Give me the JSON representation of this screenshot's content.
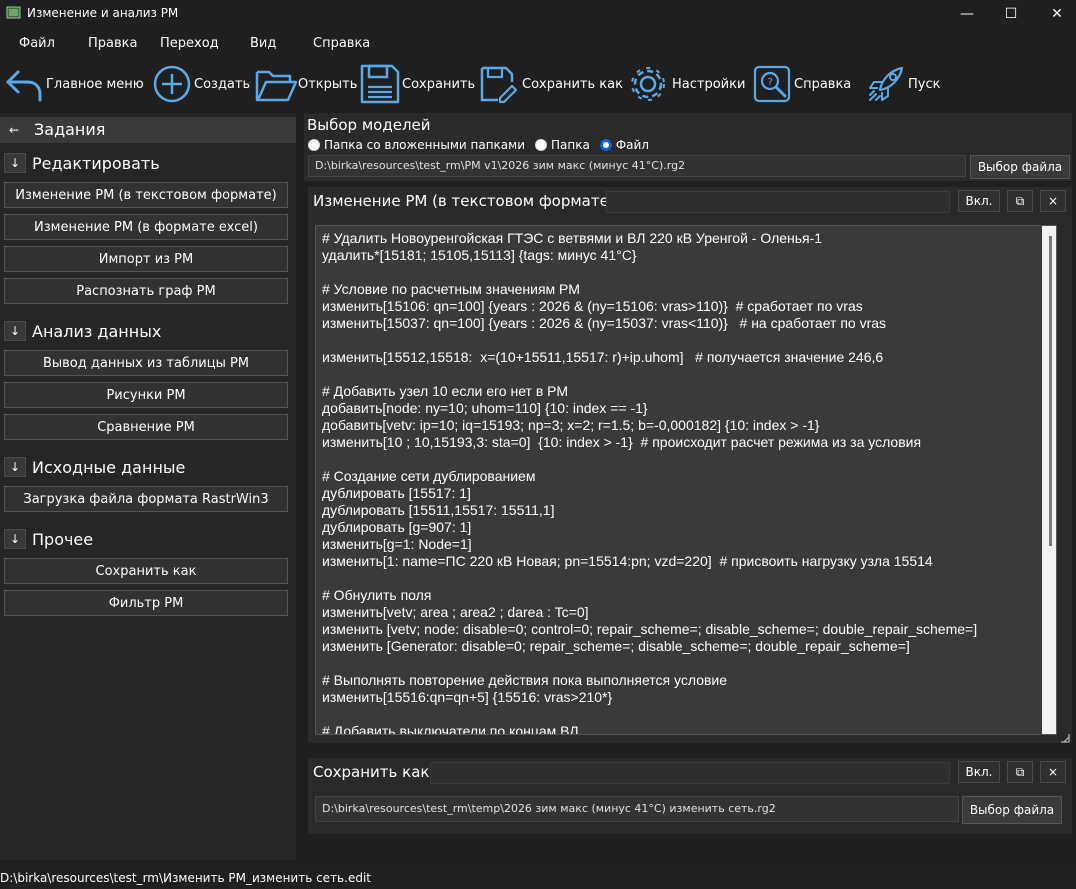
{
  "window": {
    "title": "Изменение и анализ РМ",
    "minimize": "—",
    "maximize": "☐",
    "close": "✕"
  },
  "menu": [
    "Файл",
    "Правка",
    "Переход",
    "Вид",
    "Справка"
  ],
  "toolbar": {
    "main_menu": "Главное меню",
    "create": "Создать",
    "open": "Открыть",
    "save": "Сохранить",
    "save_as": "Сохранить как",
    "settings": "Настройки",
    "help": "Справка",
    "run": "Пуск"
  },
  "sidebar": {
    "back_arrow": "←",
    "header": "Задания",
    "expand_arrow": "↓",
    "sections": [
      {
        "title": "Редактировать",
        "items": [
          "Изменение РМ (в текстовом формате)",
          "Изменение РМ (в формате excel)",
          "Импорт из РМ",
          "Распознать граф РМ"
        ]
      },
      {
        "title": "Анализ данных",
        "items": [
          "Вывод данных из таблицы РМ",
          "Рисунки РМ",
          "Сравнение РМ"
        ]
      },
      {
        "title": "Исходные данные",
        "items": [
          "Загрузка файла формата RastrWin3"
        ]
      },
      {
        "title": "Прочее",
        "items": [
          "Сохранить как",
          "Фильтр РМ"
        ]
      }
    ]
  },
  "model_select": {
    "title": "Выбор моделей",
    "options": [
      "Папка со вложенными папками",
      "Папка",
      "Файл"
    ],
    "selected": "Файл",
    "path": "D:\\birka\\resources\\test_rm\\РМ v1\\2026 зим макс (минус 41°С).rg2",
    "browse": "Выбор файла"
  },
  "editor_panel": {
    "title": "Изменение РМ (в текстовом формате)",
    "toggle": "Вкл.",
    "copy": "⧉",
    "close": "×",
    "lines": [
      "# Удалить Новоуренгойская ГТЭС с ветвями и ВЛ 220 кВ Уренгой - Оленья-1",
      "удалить*[15181; 15105,15113] {tags: минус 41°С}",
      "",
      "# Условие по расчетным значениям РМ",
      "изменить[15106: qn=100] {years : 2026 & (ny=15106: vras>110)}  # сработает по vras",
      "изменить[15037: qn=100] {years : 2026 & (ny=15037: vras<110)}   # на сработает по vras",
      "",
      "изменить[15512,15518:  x=(10+15511,15517: r)+ip.uhom]   # получается значение 246,6",
      "",
      "# Добавить узел 10 если его нет в РМ",
      "добавить[node: ny=10; uhom=110] {10: index == -1}",
      "добавить[vetv: ip=10; iq=15193; np=3; x=2; r=1.5; b=-0,000182] {10: index > -1}",
      "изменить[10 ; 10,15193,3: sta=0]  {10: index > -1}  # происходит расчет режима из за условия",
      "",
      "# Создание сети дублированием",
      "дублировать [15517: 1]",
      "дублировать [15511,15517: 15511,1]",
      "дублировать [g=907: 1]",
      "изменить[g=1: Node=1]",
      "изменить[1: name=ПС 220 кВ Новая; pn=15514:pn; vzd=220]  # присвоить нагрузку узла 15514",
      "",
      "# Обнулить поля",
      "изменить[vetv; area ; area2 ; darea : Tc=0]",
      "изменить [vetv; node: disable=0; control=0; repair_scheme=; disable_scheme=; double_repair_scheme=]",
      "изменить [Generator: disable=0; repair_scheme=; disable_scheme=; double_repair_scheme=]",
      "",
      "# Выполнять повторение действия пока выполняется условие",
      "изменить[15516:qn=qn+5] {15516: vras>210*}",
      "",
      "# Добавить выключатели по концам ВЛ"
    ]
  },
  "save_panel": {
    "title": "Сохранить как",
    "toggle": "Вкл.",
    "copy": "⧉",
    "close": "×",
    "path": "D:\\birka\\resources\\test_rm\\temp\\2026 зим макс (минус 41°С) изменить сеть.rg2",
    "browse": "Выбор файла"
  },
  "status": "D:\\birka\\resources\\test_rm\\Изменить РМ_изменить сеть.edit",
  "colors": {
    "accent": "#0a64d8",
    "icon_blue": "#5aa9e6",
    "background": "#1f1f1f",
    "panel": "#2a2a2a"
  }
}
